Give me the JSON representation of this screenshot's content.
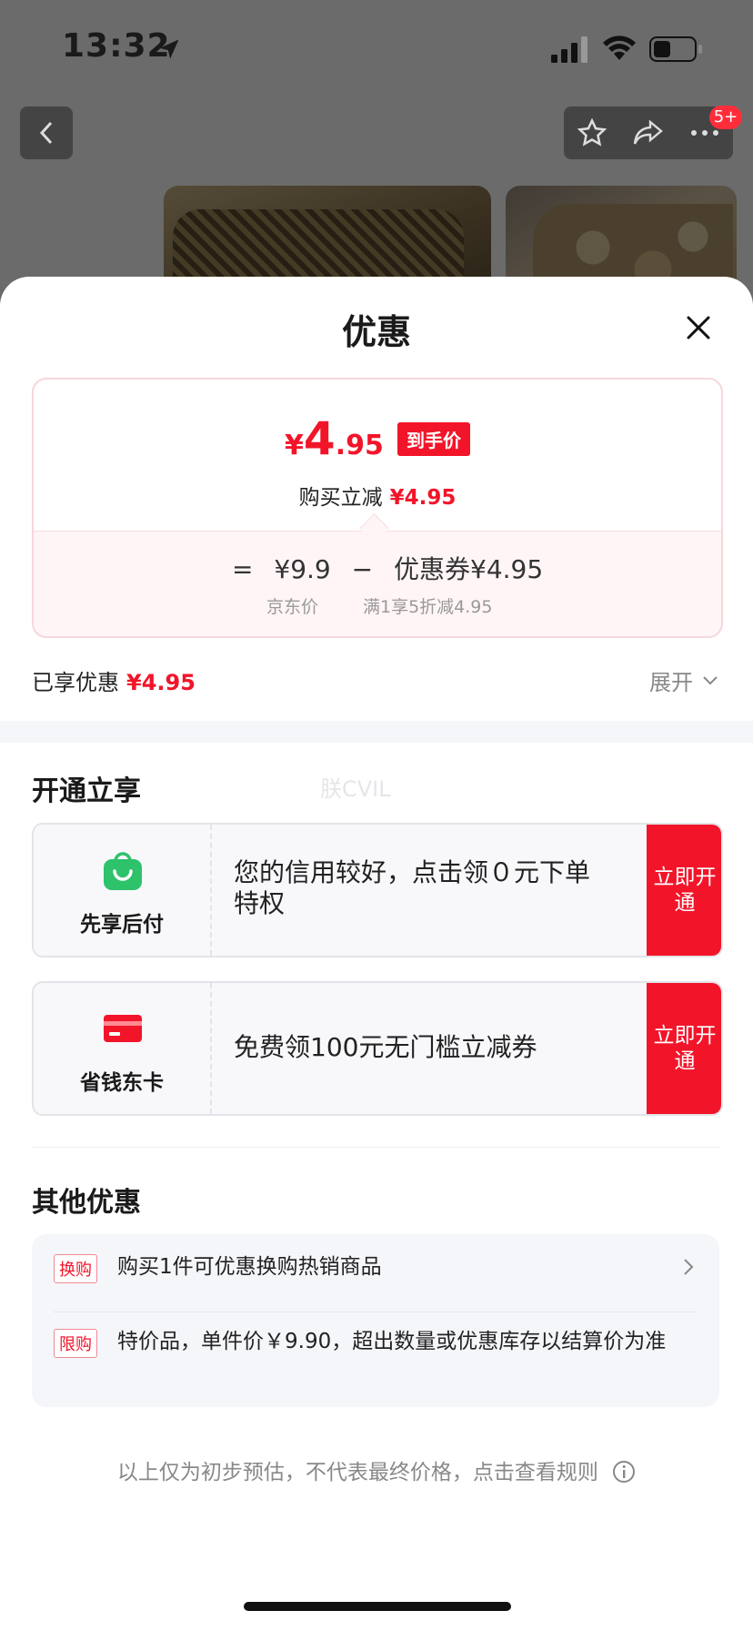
{
  "status_bar": {
    "time": "13:32"
  },
  "nav": {
    "badge": "5+"
  },
  "sheet": {
    "title": "优惠",
    "price_card": {
      "final_yen": "¥",
      "final_int": "4",
      "final_dec": ".95",
      "final_tag": "到手价",
      "sub_label": "购买立减",
      "sub_value": "¥4.95",
      "eq": "=",
      "jd_price": "¥9.9",
      "minus": "−",
      "coupon": "优惠券¥4.95",
      "jd_price_label": "京东价",
      "coupon_desc": "满1享5折减4.95"
    },
    "enjoyed": {
      "label": "已享优惠",
      "value": "¥4.95"
    },
    "expand": "展开",
    "open_section": {
      "title": "开通立享",
      "watermark": "朕CVIL",
      "offers": [
        {
          "label": "先享后付",
          "text": "您的信用较好，点击领０元下单特权",
          "button": "立即开通",
          "icon": "shopping-bag-icon"
        },
        {
          "label": "省钱东卡",
          "text": "免费领100元无门槛立减券",
          "button": "立即开通",
          "icon": "card-icon"
        }
      ]
    },
    "other_section": {
      "title": "其他优惠",
      "items": [
        {
          "tag": "换购",
          "text": "购买1件可优惠换购热销商品"
        },
        {
          "tag": "限购",
          "text": "特价品，单件价￥9.90，超出数量或优惠库存以结算价为准"
        }
      ]
    },
    "footer": "以上仅为初步预估，不代表最终价格，点击查看规则"
  },
  "colors": {
    "accent": "#f2152a",
    "green": "#2ec26b"
  }
}
